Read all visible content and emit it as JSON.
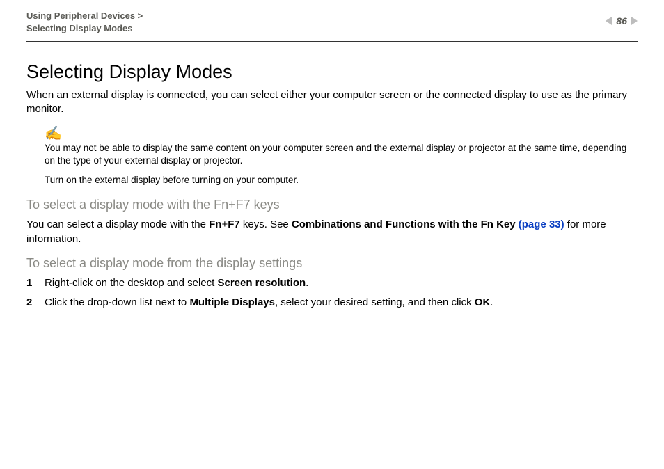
{
  "header": {
    "breadcrumb1": "Using Peripheral Devices >",
    "breadcrumb2": "Selecting Display Modes",
    "page_number": "86"
  },
  "title": "Selecting Display Modes",
  "intro": "When an external display is connected, you can select either your computer screen or the connected display to use as the primary monitor.",
  "note_icon": "✍",
  "note1": "You may not be able to display the same content on your computer screen and the external display or projector at the same time, depending on the type of your external display or projector.",
  "note2": "Turn on the external display before turning on your computer.",
  "sub1": "To select a display mode with the Fn+F7 keys",
  "p1": {
    "pre": "You can select a display mode with the ",
    "fn": "Fn",
    "plus": "+",
    "f7": "F7",
    "mid": " keys. See ",
    "combo": "Combinations and Functions with the Fn Key",
    "space": " ",
    "link": "(page 33)",
    "post": " for more information."
  },
  "sub2": "To select a display mode from the display settings",
  "steps": [
    {
      "num": "1",
      "pre": "Right-click on the desktop and select ",
      "bold": "Screen resolution",
      "post": "."
    },
    {
      "num": "2",
      "pre": "Click the drop-down list next to ",
      "bold": "Multiple Displays",
      "mid": ", select your desired setting, and then click ",
      "bold2": "OK",
      "post": "."
    }
  ]
}
